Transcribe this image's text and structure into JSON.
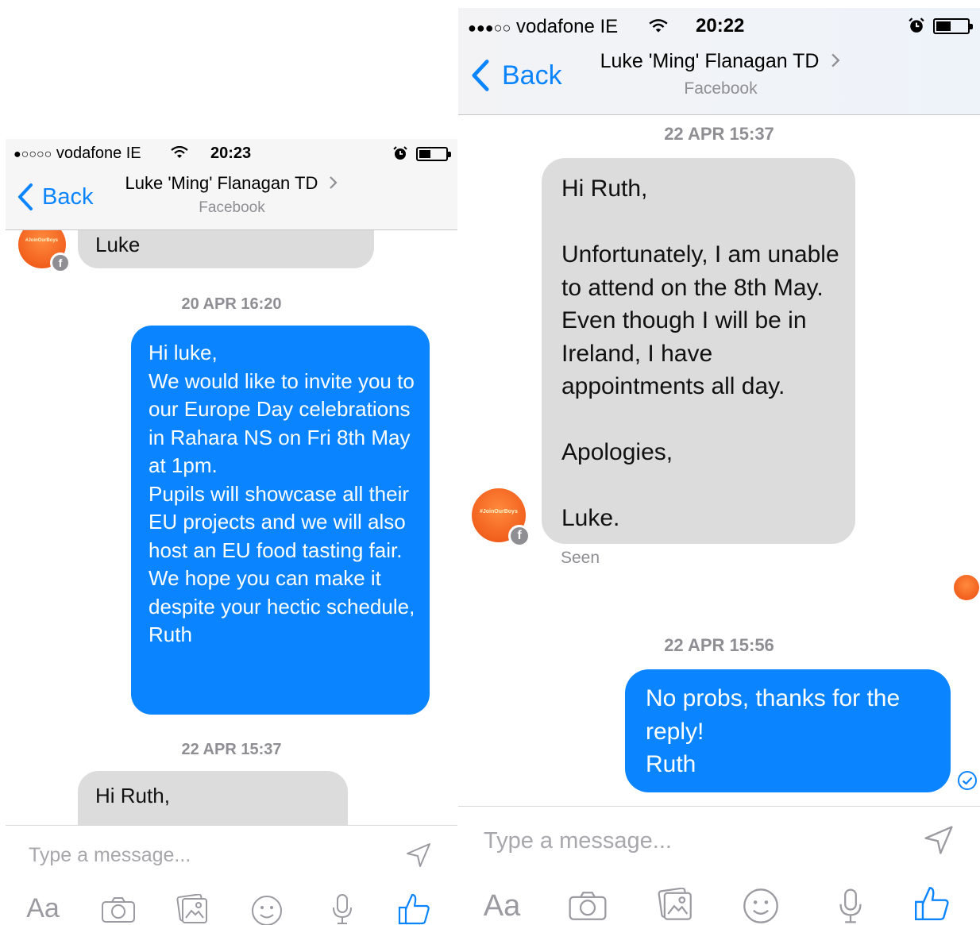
{
  "status": {
    "carrier": "vodafone IE",
    "left_time": "20:23",
    "right_time": "20:22",
    "left_signal": "●○○○○",
    "right_signal": "●●●○○"
  },
  "header": {
    "back_label": "Back",
    "title": "Luke 'Ming' Flanagan TD",
    "subtitle": "Facebook"
  },
  "left": {
    "prev_message": "Luke",
    "stamp1": "20 APR 16:20",
    "invite_message": "Hi luke,\nWe would like to invite you to our Europe Day celebrations in Rahara NS on Fri 8th May at 1pm.\nPupils will showcase all their EU projects and we will also host an EU food tasting fair.\nWe hope you can make it despite your hectic schedule,\nRuth",
    "stamp2": "22 APR 15:37",
    "partial_reply": "Hi Ruth,"
  },
  "right": {
    "stamp1": "22 APR 15:37",
    "reply_message": "Hi Ruth,\n\nUnfortunately, I am unable to attend on the 8th May. Even though I will be in Ireland, I have appointments all day.\n\nApologies,\n\nLuke.",
    "seen_label": "Seen",
    "stamp2": "22 APR 15:56",
    "response_message": "No probs, thanks for the reply!\nRuth"
  },
  "composer": {
    "placeholder": "Type a message...",
    "text_tool": "Aa"
  },
  "avatar_tag": "#JoinOurBoys",
  "colors": {
    "accent": "#0a84ff",
    "incoming_bubble": "#dcdcdc",
    "header_bg": "#f6f6f7",
    "avatar": "#ec4e10"
  },
  "icons": [
    "wifi-icon",
    "alarm-icon",
    "battery-icon",
    "back-chevron-icon",
    "title-chevron-icon",
    "facebook-badge-icon",
    "send-icon",
    "camera-icon",
    "gallery-icon",
    "emoji-icon",
    "microphone-icon",
    "thumbs-up-icon",
    "delivered-check-icon"
  ]
}
